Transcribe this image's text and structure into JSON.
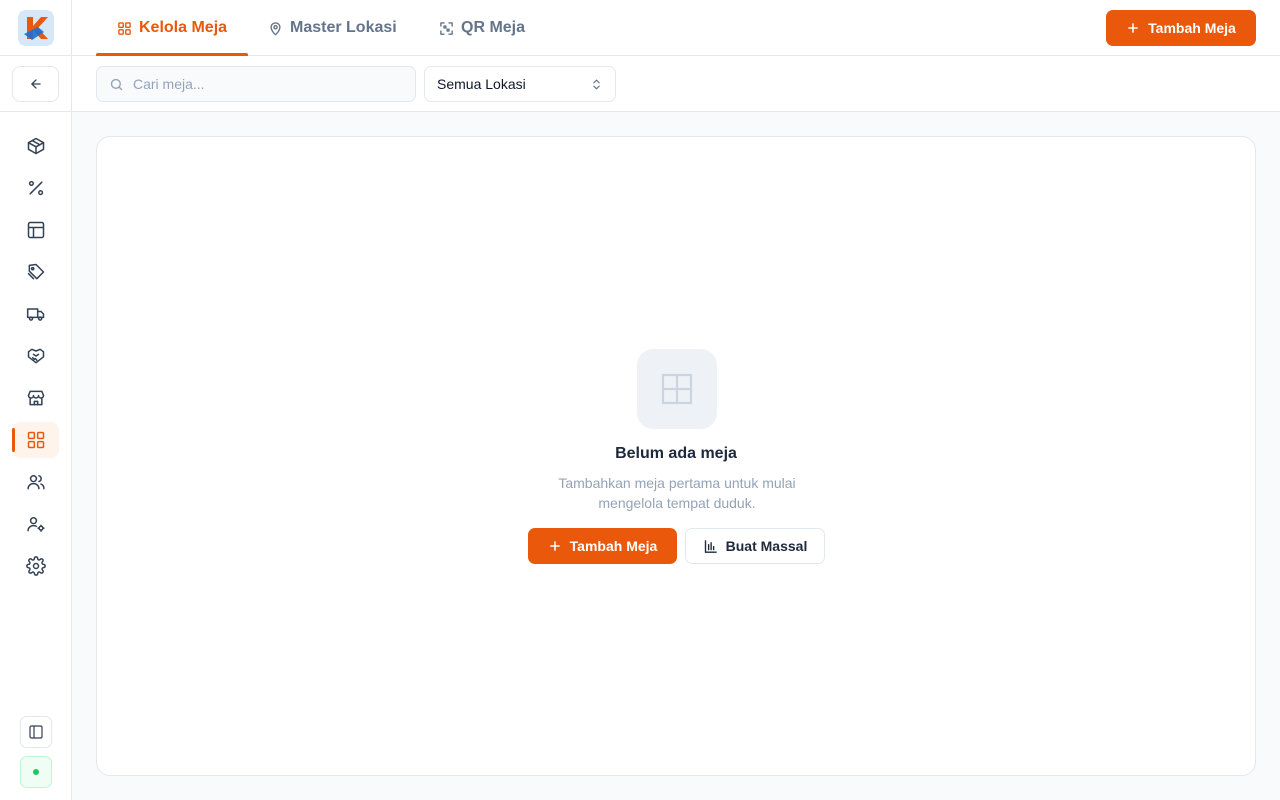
{
  "sidebar": {
    "logo_letter": "K",
    "items": [
      {
        "icon": "box-icon",
        "name": "sidebar-item-products",
        "active": false
      },
      {
        "icon": "percent-icon",
        "name": "sidebar-item-promotions",
        "active": false
      },
      {
        "icon": "layout-icon",
        "name": "sidebar-item-layout",
        "active": false
      },
      {
        "icon": "tag-icon",
        "name": "sidebar-item-tags",
        "active": false
      },
      {
        "icon": "truck-icon",
        "name": "sidebar-item-delivery",
        "active": false
      },
      {
        "icon": "handshake-icon",
        "name": "sidebar-item-partners",
        "active": false
      },
      {
        "icon": "store-icon",
        "name": "sidebar-item-store",
        "active": false
      },
      {
        "icon": "grid-icon",
        "name": "sidebar-item-tables",
        "active": true
      },
      {
        "icon": "users-icon",
        "name": "sidebar-item-users",
        "active": false
      },
      {
        "icon": "user-settings-icon",
        "name": "sidebar-item-user-settings",
        "active": false
      },
      {
        "icon": "gear-icon",
        "name": "sidebar-item-settings",
        "active": false
      }
    ]
  },
  "header": {
    "tabs": [
      {
        "label": "Kelola Meja",
        "icon": "grid-icon",
        "active": true
      },
      {
        "label": "Master Lokasi",
        "icon": "map-pin-icon",
        "active": false
      },
      {
        "label": "QR Meja",
        "icon": "qr-icon",
        "active": false
      }
    ],
    "add_button_label": "Tambah Meja"
  },
  "filters": {
    "search_placeholder": "Cari meja...",
    "location_selected": "Semua Lokasi"
  },
  "empty_state": {
    "title": "Belum ada meja",
    "description": "Tambahkan meja pertama untuk mulai mengelola tempat duduk.",
    "add_button_label": "Tambah Meja",
    "bulk_button_label": "Buat Massal"
  },
  "colors": {
    "accent": "#ea580c",
    "text": "#1e293b",
    "muted": "#94a3b8",
    "border": "#e5e7eb"
  }
}
